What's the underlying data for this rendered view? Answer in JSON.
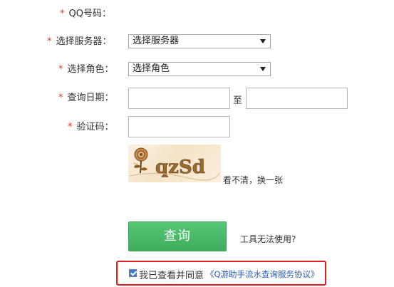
{
  "form": {
    "qq": {
      "star": "*",
      "label": "QQ号码："
    },
    "server": {
      "star": "*",
      "label": "选择服务器：",
      "selected": "选择服务器"
    },
    "role": {
      "star": "*",
      "label": "选择角色：",
      "selected": "选择角色"
    },
    "date": {
      "star": "*",
      "label": "查询日期：",
      "to_label": "至",
      "start_value": "",
      "end_value": ""
    },
    "captcha": {
      "star": "*",
      "label": "验证码：",
      "input_value": "",
      "image_text": "qzSd",
      "refresh_link": "看不清，换一张"
    }
  },
  "actions": {
    "query_button": "查询",
    "help_link": "工具无法使用?"
  },
  "agreement": {
    "checked": true,
    "text": "我已查看并同意",
    "link": "《Q游助手流水查询服务协议》"
  },
  "colors": {
    "required_star": "#e8391b",
    "query_button": "#4cbb6a",
    "highlight_border": "#e02020",
    "link": "#2a5db0"
  }
}
